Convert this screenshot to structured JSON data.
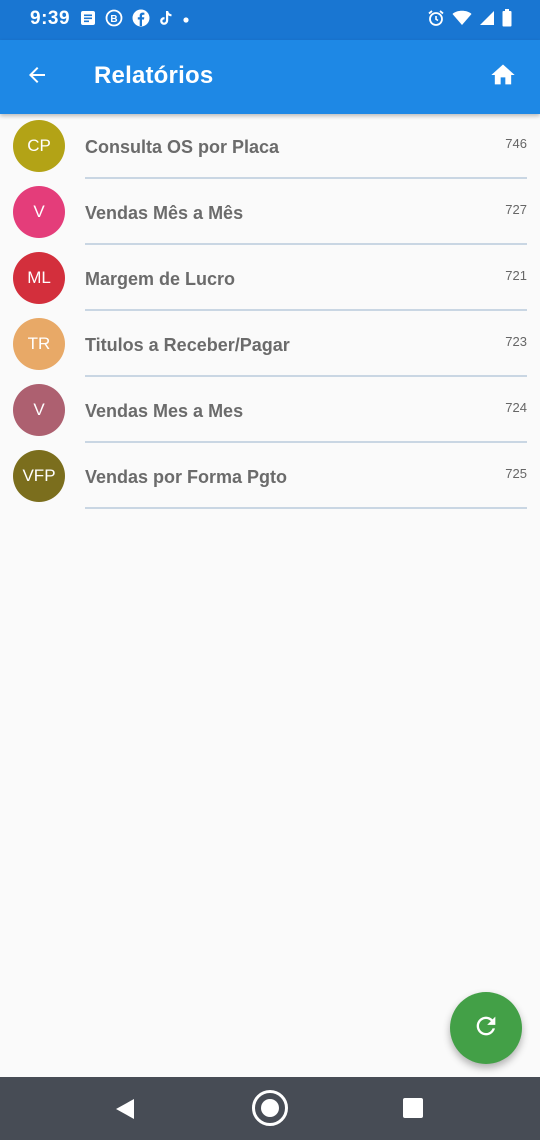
{
  "status_bar": {
    "time": "9:39",
    "left_icons": [
      "notes-icon",
      "b-circle-icon",
      "facebook-icon",
      "tiktok-icon",
      "dot-icon"
    ],
    "right_icons": [
      "alarm-icon",
      "wifi-icon",
      "signal-icon",
      "battery-icon"
    ]
  },
  "app_bar": {
    "title": "Relatórios",
    "back_icon": "arrow-back-icon",
    "home_icon": "home-icon"
  },
  "reports": [
    {
      "initials": "CP",
      "title": "Consulta OS por Placa",
      "code": "746",
      "color": "#b3a316"
    },
    {
      "initials": "V",
      "title": "Vendas Mês a Mês",
      "code": "727",
      "color": "#e43d7a"
    },
    {
      "initials": "ML",
      "title": "Margem de Lucro",
      "code": "721",
      "color": "#d32f3c"
    },
    {
      "initials": "TR",
      "title": "Titulos a Receber/Pagar",
      "code": "723",
      "color": "#e8a967"
    },
    {
      "initials": "V",
      "title": "Vendas Mes a Mes",
      "code": "724",
      "color": "#ad6070"
    },
    {
      "initials": "VFP",
      "title": "Vendas por Forma Pgto",
      "code": "725",
      "color": "#7b6e1d"
    }
  ],
  "fab": {
    "icon": "refresh-icon",
    "color": "#43a047"
  },
  "colors": {
    "status_bar": "#1976d2",
    "app_bar": "#1e88e5",
    "background": "#fafafa",
    "nav_bar": "#474c55"
  }
}
